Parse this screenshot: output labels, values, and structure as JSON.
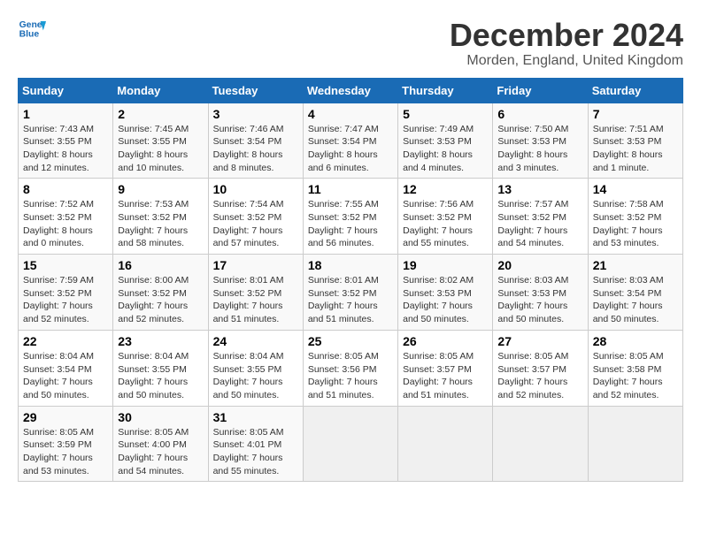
{
  "logo": {
    "line1": "General",
    "line2": "Blue"
  },
  "title": "December 2024",
  "location": "Morden, England, United Kingdom",
  "days_header": [
    "Sunday",
    "Monday",
    "Tuesday",
    "Wednesday",
    "Thursday",
    "Friday",
    "Saturday"
  ],
  "weeks": [
    [
      {
        "num": "1",
        "sunrise": "7:43 AM",
        "sunset": "3:55 PM",
        "daylight": "8 hours and 12 minutes."
      },
      {
        "num": "2",
        "sunrise": "7:45 AM",
        "sunset": "3:55 PM",
        "daylight": "8 hours and 10 minutes."
      },
      {
        "num": "3",
        "sunrise": "7:46 AM",
        "sunset": "3:54 PM",
        "daylight": "8 hours and 8 minutes."
      },
      {
        "num": "4",
        "sunrise": "7:47 AM",
        "sunset": "3:54 PM",
        "daylight": "8 hours and 6 minutes."
      },
      {
        "num": "5",
        "sunrise": "7:49 AM",
        "sunset": "3:53 PM",
        "daylight": "8 hours and 4 minutes."
      },
      {
        "num": "6",
        "sunrise": "7:50 AM",
        "sunset": "3:53 PM",
        "daylight": "8 hours and 3 minutes."
      },
      {
        "num": "7",
        "sunrise": "7:51 AM",
        "sunset": "3:53 PM",
        "daylight": "8 hours and 1 minute."
      }
    ],
    [
      {
        "num": "8",
        "sunrise": "7:52 AM",
        "sunset": "3:52 PM",
        "daylight": "8 hours and 0 minutes."
      },
      {
        "num": "9",
        "sunrise": "7:53 AM",
        "sunset": "3:52 PM",
        "daylight": "7 hours and 58 minutes."
      },
      {
        "num": "10",
        "sunrise": "7:54 AM",
        "sunset": "3:52 PM",
        "daylight": "7 hours and 57 minutes."
      },
      {
        "num": "11",
        "sunrise": "7:55 AM",
        "sunset": "3:52 PM",
        "daylight": "7 hours and 56 minutes."
      },
      {
        "num": "12",
        "sunrise": "7:56 AM",
        "sunset": "3:52 PM",
        "daylight": "7 hours and 55 minutes."
      },
      {
        "num": "13",
        "sunrise": "7:57 AM",
        "sunset": "3:52 PM",
        "daylight": "7 hours and 54 minutes."
      },
      {
        "num": "14",
        "sunrise": "7:58 AM",
        "sunset": "3:52 PM",
        "daylight": "7 hours and 53 minutes."
      }
    ],
    [
      {
        "num": "15",
        "sunrise": "7:59 AM",
        "sunset": "3:52 PM",
        "daylight": "7 hours and 52 minutes."
      },
      {
        "num": "16",
        "sunrise": "8:00 AM",
        "sunset": "3:52 PM",
        "daylight": "7 hours and 52 minutes."
      },
      {
        "num": "17",
        "sunrise": "8:01 AM",
        "sunset": "3:52 PM",
        "daylight": "7 hours and 51 minutes."
      },
      {
        "num": "18",
        "sunrise": "8:01 AM",
        "sunset": "3:52 PM",
        "daylight": "7 hours and 51 minutes."
      },
      {
        "num": "19",
        "sunrise": "8:02 AM",
        "sunset": "3:53 PM",
        "daylight": "7 hours and 50 minutes."
      },
      {
        "num": "20",
        "sunrise": "8:03 AM",
        "sunset": "3:53 PM",
        "daylight": "7 hours and 50 minutes."
      },
      {
        "num": "21",
        "sunrise": "8:03 AM",
        "sunset": "3:54 PM",
        "daylight": "7 hours and 50 minutes."
      }
    ],
    [
      {
        "num": "22",
        "sunrise": "8:04 AM",
        "sunset": "3:54 PM",
        "daylight": "7 hours and 50 minutes."
      },
      {
        "num": "23",
        "sunrise": "8:04 AM",
        "sunset": "3:55 PM",
        "daylight": "7 hours and 50 minutes."
      },
      {
        "num": "24",
        "sunrise": "8:04 AM",
        "sunset": "3:55 PM",
        "daylight": "7 hours and 50 minutes."
      },
      {
        "num": "25",
        "sunrise": "8:05 AM",
        "sunset": "3:56 PM",
        "daylight": "7 hours and 51 minutes."
      },
      {
        "num": "26",
        "sunrise": "8:05 AM",
        "sunset": "3:57 PM",
        "daylight": "7 hours and 51 minutes."
      },
      {
        "num": "27",
        "sunrise": "8:05 AM",
        "sunset": "3:57 PM",
        "daylight": "7 hours and 52 minutes."
      },
      {
        "num": "28",
        "sunrise": "8:05 AM",
        "sunset": "3:58 PM",
        "daylight": "7 hours and 52 minutes."
      }
    ],
    [
      {
        "num": "29",
        "sunrise": "8:05 AM",
        "sunset": "3:59 PM",
        "daylight": "7 hours and 53 minutes."
      },
      {
        "num": "30",
        "sunrise": "8:05 AM",
        "sunset": "4:00 PM",
        "daylight": "7 hours and 54 minutes."
      },
      {
        "num": "31",
        "sunrise": "8:05 AM",
        "sunset": "4:01 PM",
        "daylight": "7 hours and 55 minutes."
      },
      null,
      null,
      null,
      null
    ]
  ],
  "sunrise_label": "Sunrise:",
  "sunset_label": "Sunset:",
  "daylight_label": "Daylight:"
}
